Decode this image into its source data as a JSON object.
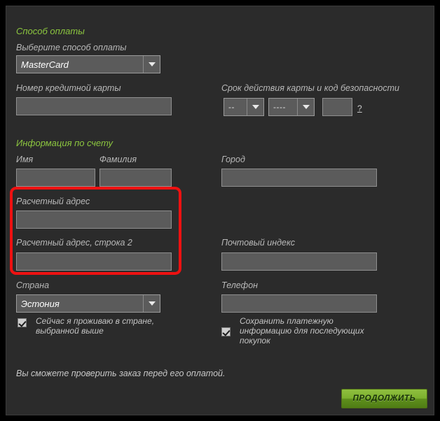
{
  "payment_section": {
    "title": "Способ оплаты",
    "method_label": "Выберите способ оплаты",
    "method_value": "MasterCard",
    "card_number_label": "Номер кредитной карты",
    "card_number_value": "",
    "expiry_label": "Срок действия карты и код безопасности",
    "expiry_month_value": "--",
    "expiry_year_value": "----",
    "cvv_value": "",
    "cvv_help": "?"
  },
  "account_section": {
    "title": "Информация по счету",
    "first_name_label": "Имя",
    "first_name_value": "",
    "last_name_label": "Фамилия",
    "last_name_value": "",
    "city_label": "Город",
    "city_value": "",
    "address1_label": "Расчетный адрес",
    "address1_value": "",
    "address2_label": "Расчетный адрес, строка 2",
    "address2_value": "",
    "postal_label": "Почтовый индекс",
    "postal_value": "",
    "country_label": "Страна",
    "country_value": "Эстония",
    "phone_label": "Телефон",
    "phone_value": ""
  },
  "checkboxes": {
    "reside_line1": "Сейчас я проживаю в стране,",
    "reside_line2": "выбранной выше",
    "save_line1": "Сохранить платежную",
    "save_line2": "информацию для последующих",
    "save_line3": "покупок"
  },
  "footer": {
    "note": "Вы сможете проверить заказ перед его оплатой.",
    "continue_label": "ПРОДОЛЖИТЬ"
  },
  "colors": {
    "accent_green": "#8cc63f",
    "panel_bg": "#2b2b2b",
    "input_bg": "#5b5b5b",
    "highlight_red": "#ee1111"
  }
}
